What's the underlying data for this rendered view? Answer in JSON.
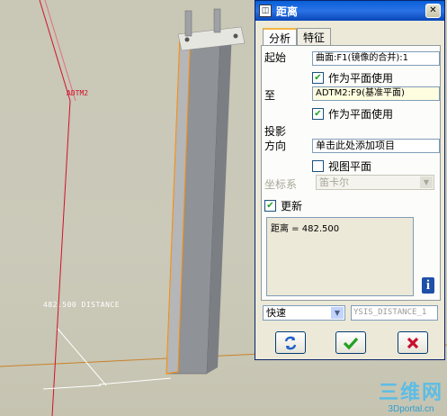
{
  "viewport": {
    "datum_label": "ADTM2",
    "distance_label": "482.500  DISTANCE"
  },
  "watermark": {
    "main": "三维网",
    "sub": "3Dportal.cn"
  },
  "dialog": {
    "title": "距离",
    "close_label": "✕",
    "tabs": [
      {
        "label": "分析",
        "active": true
      },
      {
        "label": "特征",
        "active": false
      }
    ],
    "from": {
      "label": "起始",
      "value": "曲面:F1(镜像的合并):1",
      "as_plane_label": "作为平面使用",
      "as_plane_checked": true
    },
    "to": {
      "label": "至",
      "value": "ADTM2:F9(基准平面)",
      "as_plane_label": "作为平面使用",
      "as_plane_checked": true
    },
    "projection": {
      "label_line1": "投影",
      "label_line2": "方向",
      "value": "单击此处添加项目",
      "view_plane_label": "视图平面",
      "view_plane_checked": false
    },
    "coordinate_system": {
      "label": "坐标系",
      "value": "笛卡尔"
    },
    "update": {
      "label": "更新",
      "checked": true
    },
    "result_text": "距离 = 482.500",
    "info_icon": "i",
    "mode": {
      "selected": "快速"
    },
    "feature_name": "YSIS_DISTANCE_1",
    "buttons": {
      "repeat_icon": "repeat-icon",
      "ok_icon": "checkmark-icon",
      "cancel_icon": "cancel-x-icon"
    }
  },
  "colors": {
    "viewport_bg": "#c8c6b4",
    "datum_red": "#d0102a",
    "part_gray": "#8f9297",
    "edge_orange": "#ff8c00",
    "titlebar_blue": "#0a5fd8",
    "ok_green": "#21a121",
    "cancel_red": "#c8102e",
    "watermark_blue": "#5bbde6"
  }
}
